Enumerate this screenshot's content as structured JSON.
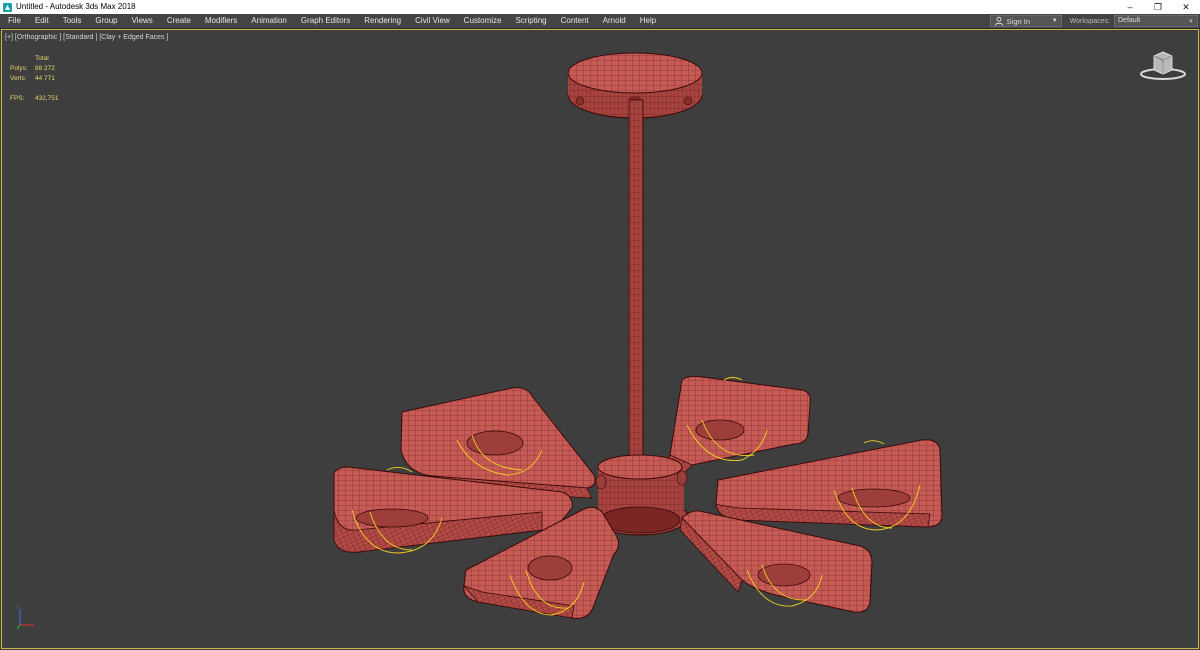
{
  "window": {
    "title": "Untitled - Autodesk 3ds Max 2018",
    "controls": {
      "minimize": "–",
      "restore": "❐",
      "close": "✕"
    }
  },
  "menu": {
    "items": [
      "File",
      "Edit",
      "Tools",
      "Group",
      "Views",
      "Create",
      "Modifiers",
      "Animation",
      "Graph Editors",
      "Rendering",
      "Civil View",
      "Customize",
      "Scripting",
      "Content",
      "Arnold",
      "Help"
    ],
    "signin_label": "Sign In",
    "workspaces_label": "Workspaces:",
    "workspace_value": "Default"
  },
  "viewport": {
    "label": "[+] [Orthographic ] [Standard ] [Clay + Edged Faces ]",
    "stats": {
      "total_label": "Total",
      "polys_label": "Polys:",
      "polys_value": "88 272",
      "verts_label": "Verts:",
      "verts_value": "44 771",
      "fps_label": "FPS:",
      "fps_value": "432,751"
    }
  },
  "colors": {
    "viewport_bg": "#3e3e3e",
    "model_fill": "#c65a55",
    "wire": "#5a1414",
    "light_gizmo": "#f0d020",
    "stats_text": "#e4d86a"
  }
}
